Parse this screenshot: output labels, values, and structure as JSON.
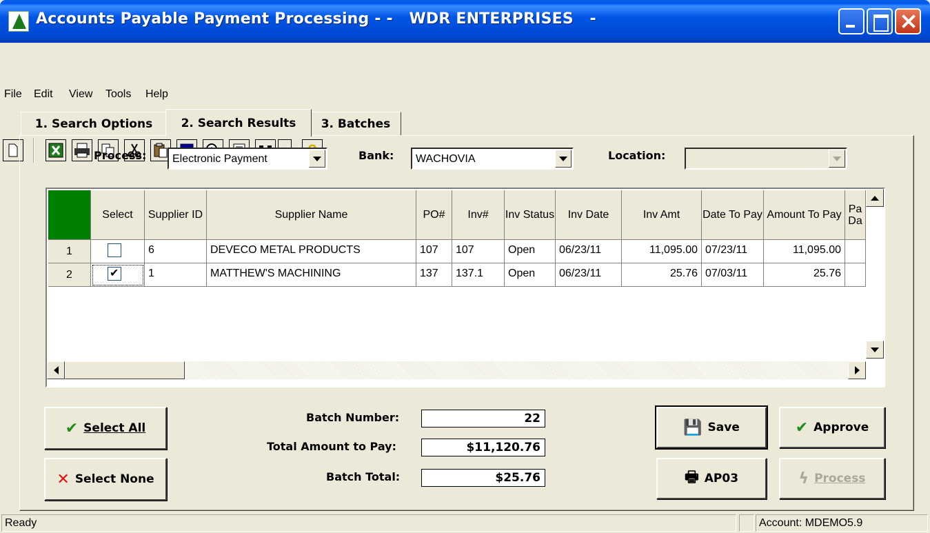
{
  "window": {
    "title": "Accounts Payable Payment Processing - -   WDR ENTERPRISES   -"
  },
  "menu": [
    "File",
    "Edit",
    "View",
    "Tools",
    "Help"
  ],
  "toolbar": {
    "icons": [
      "new-icon",
      "excel-icon",
      "print-icon",
      "copy-icon",
      "cut-icon",
      "paste-icon",
      "grid-icon",
      "zoom-icon",
      "delete-icon",
      "find-icon",
      "dropdown-icon",
      "help-icon"
    ]
  },
  "tabs": [
    "1. Search Options",
    "2. Search Results",
    "3. Batches"
  ],
  "filters": {
    "process_label": "Process:",
    "process_value": "Electronic Payment",
    "bank_label": "Bank:",
    "bank_value": "WACHOVIA",
    "location_label": "Location:",
    "location_value": ""
  },
  "grid": {
    "columns": [
      "Select",
      "Supplier ID",
      "Supplier Name",
      "PO#",
      "Inv#",
      "Inv Status",
      "Inv Date",
      "Inv Amt",
      "Date To Pay",
      "Amount To Pay",
      "Pa Da"
    ],
    "rows": [
      {
        "num": "1",
        "selected": false,
        "supplier_id": "6",
        "supplier_name": "DEVECO METAL PRODUCTS",
        "po": "107",
        "inv": "107",
        "status": "Open",
        "inv_date": "06/23/11",
        "inv_amt": "11,095.00",
        "date_to_pay": "07/23/11",
        "amount_to_pay": "11,095.00"
      },
      {
        "num": "2",
        "selected": true,
        "supplier_id": "1",
        "supplier_name": "MATTHEW'S MACHINING",
        "po": "137",
        "inv": "137.1",
        "status": "Open",
        "inv_date": "06/23/11",
        "inv_amt": "25.76",
        "date_to_pay": "07/03/11",
        "amount_to_pay": "25.76"
      }
    ]
  },
  "buttons": {
    "select_all": "Select All",
    "select_none": "Select None",
    "save": "Save",
    "approve": "Approve",
    "ap03": "AP03",
    "process": "Process"
  },
  "totals": {
    "batch_number_label": "Batch Number:",
    "batch_number": "22",
    "total_amount_label": "Total Amount to Pay:",
    "total_amount": "$11,120.76",
    "batch_total_label": "Batch Total:",
    "batch_total": "$25.76"
  },
  "status": {
    "text": "Ready",
    "account": "Account: MDEMO5.9"
  },
  "colors": {
    "titlebar": "#0055E5",
    "face": "#ECE9D8",
    "corner_header": "#008000",
    "check_green": "#1E8C1E",
    "cross_red": "#E01010"
  }
}
